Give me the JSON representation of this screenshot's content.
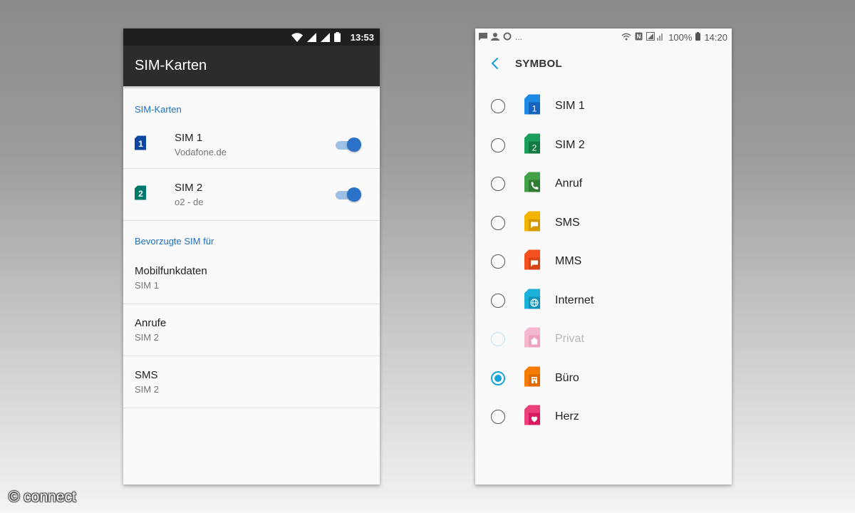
{
  "left_screen": {
    "status_bar": {
      "time": "13:53"
    },
    "app_bar": {
      "title": "SIM-Karten"
    },
    "sim_section": {
      "header": "SIM-Karten"
    },
    "sims": [
      {
        "number": "1",
        "name": "SIM 1",
        "carrier": "Vodafone.de",
        "enabled": true,
        "color": "#0d47a1"
      },
      {
        "number": "2",
        "name": "SIM 2",
        "carrier": "o2 - de",
        "enabled": true,
        "color": "#00796b"
      }
    ],
    "preferred_section": {
      "header": "Bevorzugte SIM für"
    },
    "preferences": [
      {
        "title": "Mobilfunkdaten",
        "value": "SIM 1"
      },
      {
        "title": "Anrufe",
        "value": "SIM 2"
      },
      {
        "title": "SMS",
        "value": "SIM 2"
      }
    ]
  },
  "right_screen": {
    "status_bar": {
      "battery": "100%",
      "time": "14:20",
      "overflow": "..."
    },
    "top_bar": {
      "title": "SYMBOL"
    },
    "options": [
      {
        "label": "SIM 1",
        "icon": "sim-1-icon",
        "glyph": "1",
        "color": "#1e88e5",
        "selected": false,
        "disabled": false
      },
      {
        "label": "SIM 2",
        "icon": "sim-2-icon",
        "glyph": "2",
        "color": "#1b9e5a",
        "selected": false,
        "disabled": false
      },
      {
        "label": "Anruf",
        "icon": "phone-icon",
        "color": "#43a047",
        "selected": false,
        "disabled": false
      },
      {
        "label": "SMS",
        "icon": "sms-icon",
        "color": "#f3b400",
        "selected": false,
        "disabled": false
      },
      {
        "label": "MMS",
        "icon": "mms-icon",
        "color": "#f4511e",
        "selected": false,
        "disabled": false
      },
      {
        "label": "Internet",
        "icon": "globe-icon",
        "color": "#1ab0d8",
        "selected": false,
        "disabled": false
      },
      {
        "label": "Privat",
        "icon": "home-icon",
        "color": "#f4b7cf",
        "selected": false,
        "disabled": true
      },
      {
        "label": "Büro",
        "icon": "office-icon",
        "color": "#f57c00",
        "selected": true,
        "disabled": false
      },
      {
        "label": "Herz",
        "icon": "heart-icon",
        "color": "#ec407a",
        "selected": false,
        "disabled": false
      }
    ]
  },
  "watermark": {
    "text": "© connect"
  }
}
